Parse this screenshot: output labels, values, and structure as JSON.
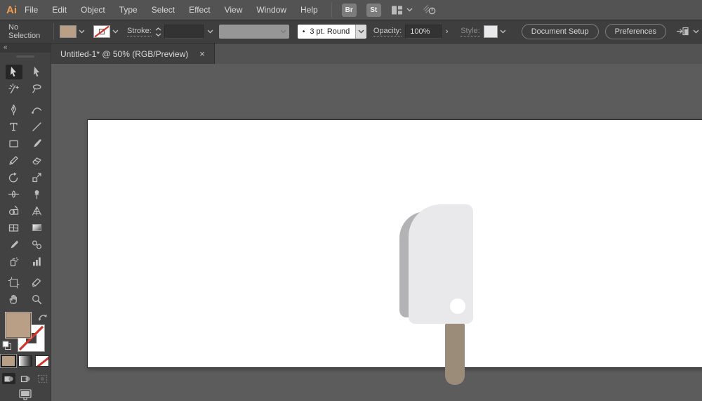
{
  "menubar": {
    "logo": "Ai",
    "items": [
      {
        "label": "File"
      },
      {
        "label": "Edit"
      },
      {
        "label": "Object"
      },
      {
        "label": "Type"
      },
      {
        "label": "Select"
      },
      {
        "label": "Effect"
      },
      {
        "label": "View"
      },
      {
        "label": "Window"
      },
      {
        "label": "Help"
      }
    ],
    "buttons": [
      {
        "label": "Br"
      },
      {
        "label": "St"
      }
    ],
    "icons": [
      "workspace-switcher-icon",
      "share-screen-icon"
    ]
  },
  "controlbar": {
    "selection_status": "No Selection",
    "stroke_label": "Stroke:",
    "brush_bullet": "•",
    "brush_name": "3 pt. Round",
    "opacity_label": "Opacity:",
    "opacity_value": "100%",
    "style_label": "Style:",
    "document_setup_label": "Document Setup",
    "preferences_label": "Preferences"
  },
  "tabbar": {
    "tabs": [
      {
        "title": "Untitled-1* @ 50% (RGB/Preview)",
        "close": "×"
      }
    ]
  },
  "toolbar": {
    "collapse_glyph": "«",
    "active_tool": "selection",
    "tools": [
      "selection",
      "direct-selection",
      "magic-wand",
      "lasso",
      "pen",
      "curvature",
      "type",
      "line-segment",
      "rectangle",
      "paintbrush",
      "pencil",
      "eraser",
      "rotate",
      "scale",
      "width",
      "puppet-warp",
      "shape-builder",
      "perspective-grid",
      "mesh",
      "gradient",
      "eyedropper",
      "blend",
      "symbol-sprayer",
      "column-graph",
      "artboard",
      "slice",
      "hand",
      "zoom"
    ],
    "swatches": {
      "fill": "#b89f86",
      "stroke": "none"
    },
    "mini_buttons": [
      "color",
      "gradient",
      "none"
    ],
    "draw_modes": [
      "draw-normal",
      "draw-behind",
      "draw-inside"
    ]
  },
  "canvas": {
    "artwork": "popsicle",
    "zoom_percent": "50%"
  },
  "colors": {
    "logo_orange": "#f09c50",
    "fill_swatch": "#b89f86",
    "none_red": "#d0342c",
    "artboard_white": "#ffffff",
    "popsicle_body": "#e9e9eb",
    "popsicle_shadow": "#b3b2b5",
    "popsicle_stick": "#9b8b79",
    "popsicle_dot": "#ffffff",
    "ui_background": "#5c5c5c"
  }
}
